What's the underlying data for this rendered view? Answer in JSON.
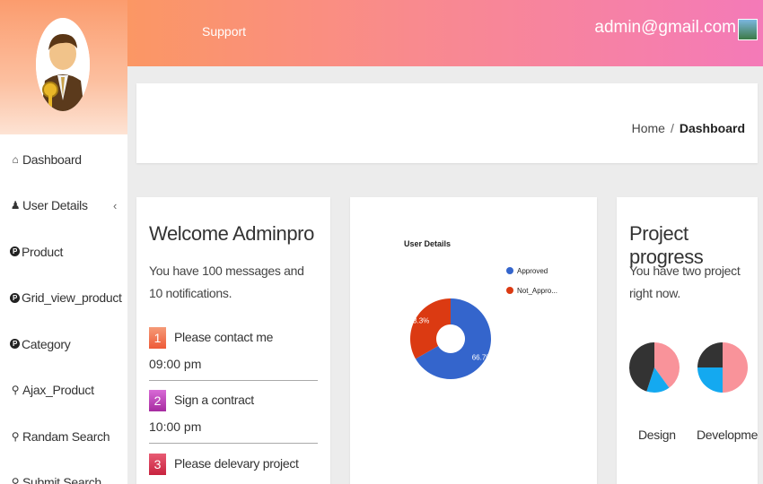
{
  "topbar": {
    "support_label": "Support",
    "user_email": "admin@gmail.com"
  },
  "sidebar": {
    "items": [
      {
        "label": "Dashboard",
        "icon": "home-icon"
      },
      {
        "label": "User Details",
        "icon": "user-icon",
        "has_submenu": true
      },
      {
        "label": "Product",
        "icon": "product-icon"
      },
      {
        "label": "Grid_view_product",
        "icon": "product-icon"
      },
      {
        "label": "Category",
        "icon": "product-icon"
      },
      {
        "label": "Ajax_Product",
        "icon": "search-icon"
      },
      {
        "label": "Randam Search",
        "icon": "search-icon"
      },
      {
        "label": "Submit Search",
        "icon": "search-icon"
      }
    ]
  },
  "breadcrumb": {
    "home": "Home",
    "separator": "/",
    "current": "Dashboard"
  },
  "welcome": {
    "title": "Welcome Adminpro",
    "intro": "You have 100 messages and 10 notifications.",
    "tasks": [
      {
        "num": "1",
        "title": "Please contact me",
        "time": "09:00 pm",
        "color": "#f2734f"
      },
      {
        "num": "2",
        "title": "Sign a contract",
        "time": "10:00 pm",
        "color": "#c53cbf"
      },
      {
        "num": "3",
        "title": "Please delevary project",
        "time": "",
        "color": "#d8324f"
      }
    ]
  },
  "user_chart": {
    "chart_data": {
      "type": "pie",
      "title": "User Details",
      "categories": [
        "Approved",
        "Not_Appro..."
      ],
      "values": [
        66.7,
        33.3
      ],
      "value_labels": [
        "66.7%",
        "33.3%"
      ],
      "colors": [
        "#3465cc",
        "#db3a12"
      ],
      "legend": "right",
      "donut": true
    }
  },
  "progress": {
    "title": "Project progress",
    "intro": "You have two project right now.",
    "projects": [
      {
        "label": "Design",
        "slices": [
          {
            "value": 40,
            "color": "#f9939a"
          },
          {
            "value": 15,
            "color": "#14a9f0"
          },
          {
            "value": 45,
            "color": "#333333"
          }
        ]
      },
      {
        "label": "Development",
        "slices": [
          {
            "value": 50,
            "color": "#f9939a"
          },
          {
            "value": 25,
            "color": "#14a9f0"
          },
          {
            "value": 25,
            "color": "#333333"
          }
        ]
      }
    ]
  }
}
